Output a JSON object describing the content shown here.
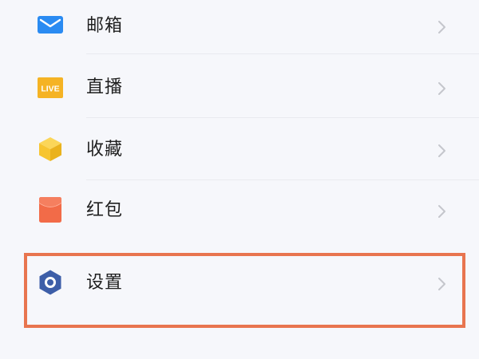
{
  "menu": {
    "items": [
      {
        "label": "邮箱",
        "icon": "mail-icon",
        "icon_color": "#2a8bf2"
      },
      {
        "label": "直播",
        "icon": "live-icon",
        "icon_color": "#f5b324",
        "badge_text": "LIVE"
      },
      {
        "label": "收藏",
        "icon": "favorites-cube-icon",
        "icon_color": "#f7c531"
      },
      {
        "label": "红包",
        "icon": "red-packet-icon",
        "icon_color": "#f26b48"
      },
      {
        "label": "设置",
        "icon": "settings-hexagon-icon",
        "icon_color": "#3d5ea8"
      }
    ]
  },
  "highlight": {
    "target": "设置",
    "color": "#e8754f"
  },
  "colors": {
    "background": "#f6f7fb",
    "text": "#1f1f1f",
    "chevron": "#c4c6cc",
    "divider": "#e9eaef"
  }
}
